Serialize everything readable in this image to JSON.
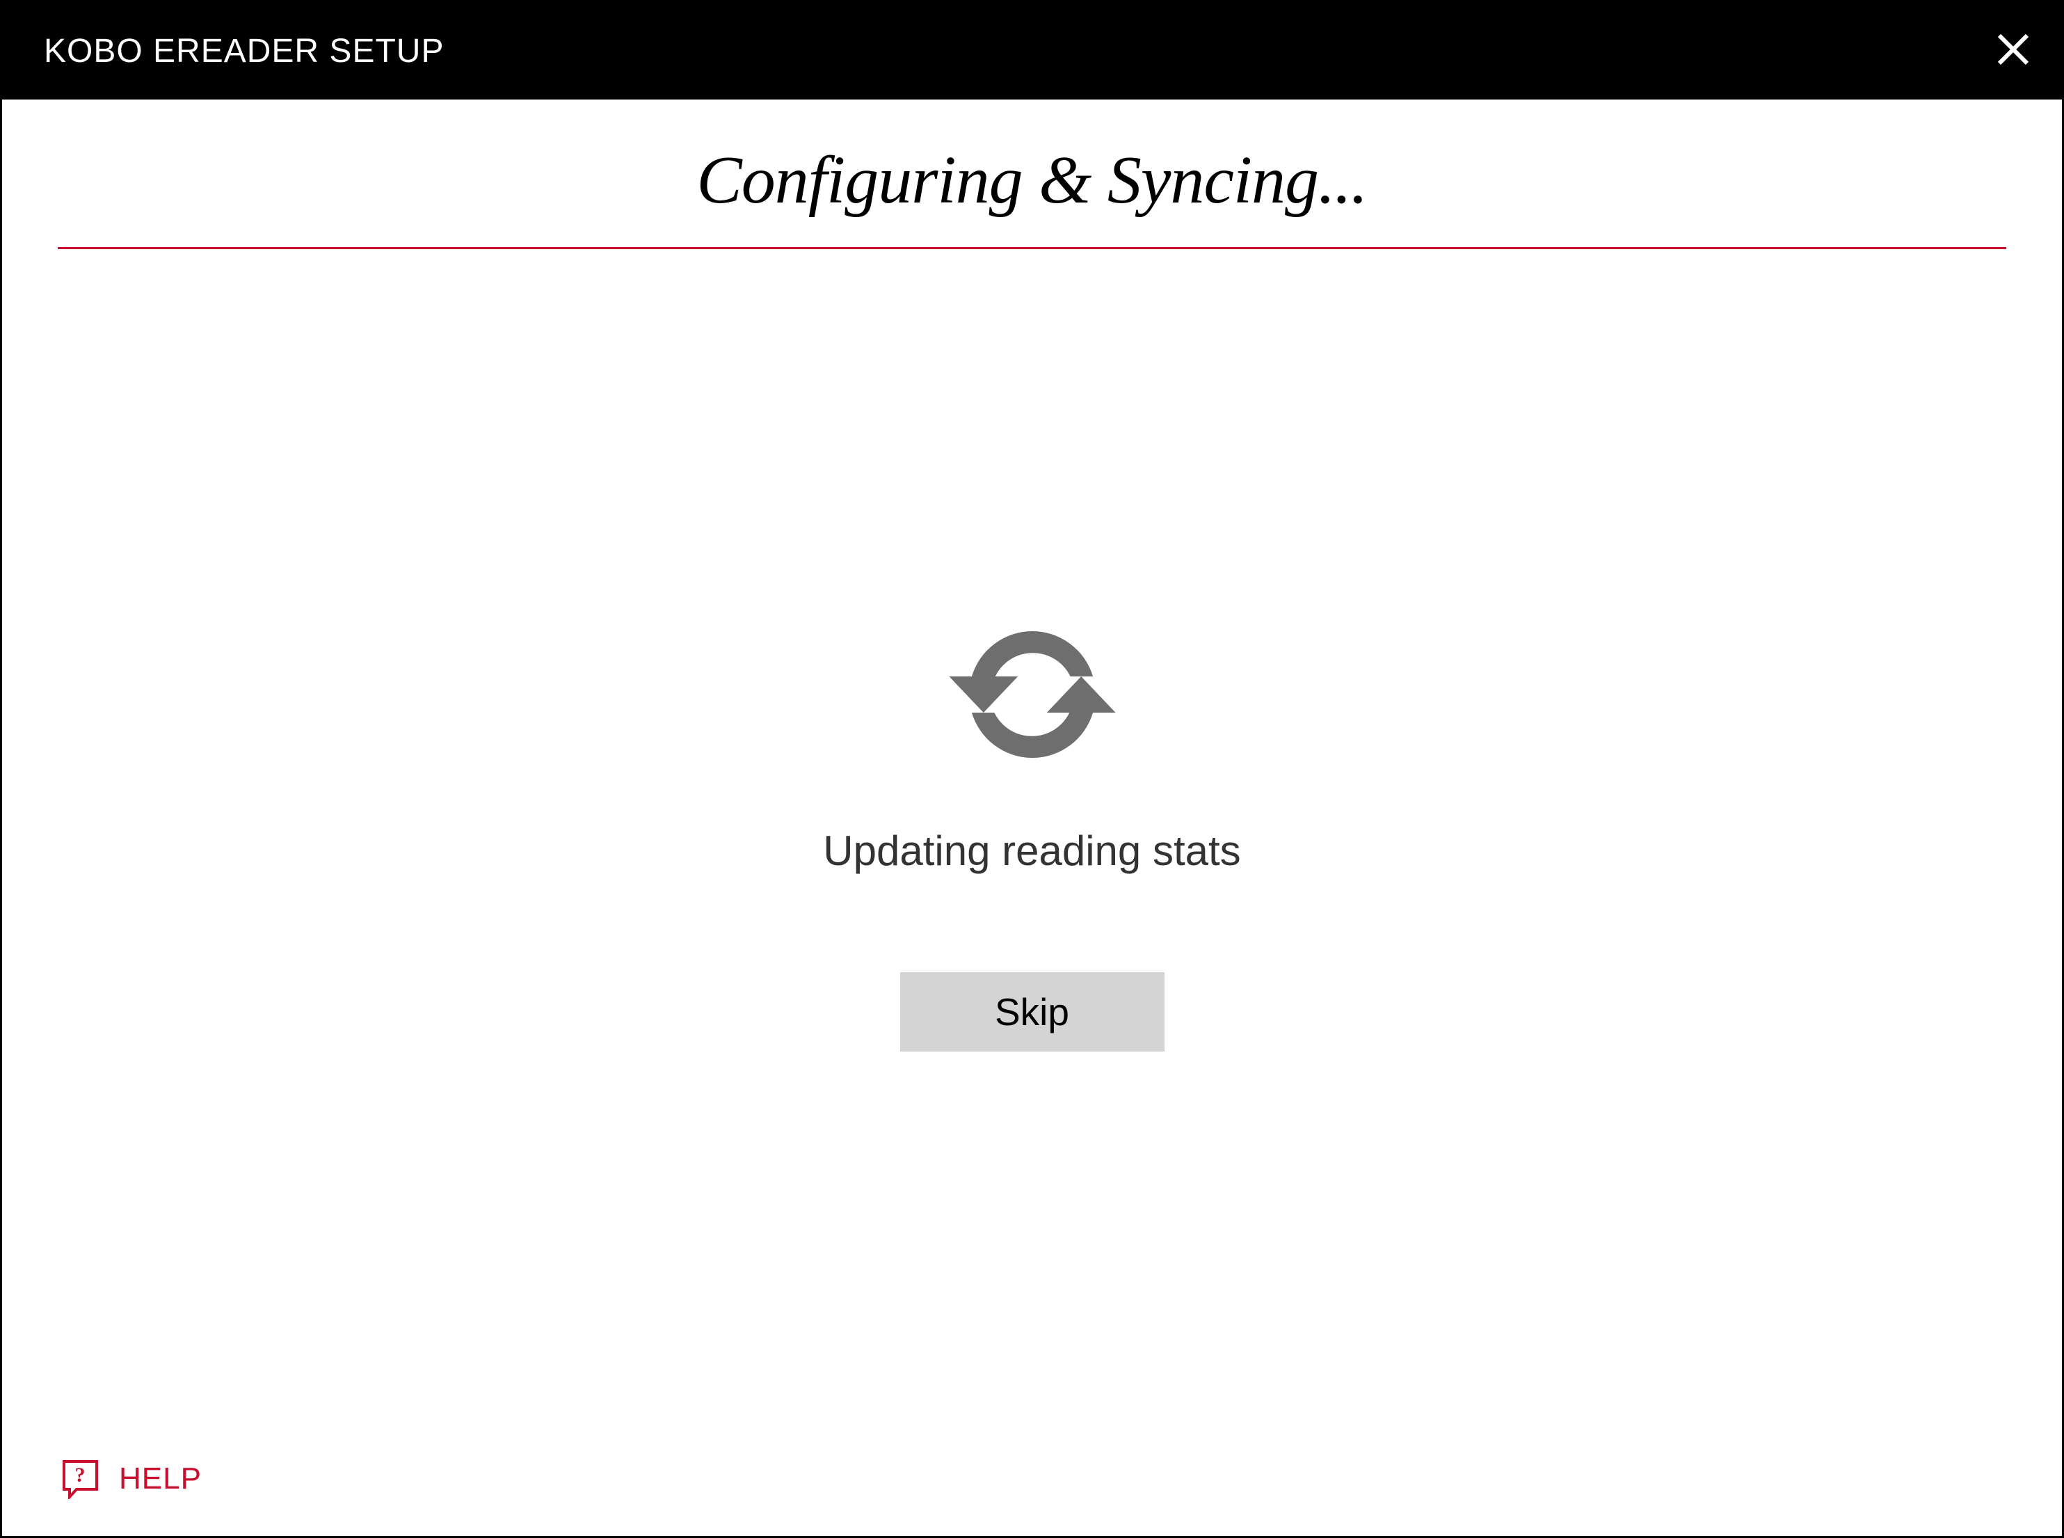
{
  "titleBar": {
    "title": "KOBO EREADER SETUP"
  },
  "heading": "Configuring & Syncing...",
  "statusText": "Updating reading stats",
  "skipButton": "Skip",
  "help": {
    "label": "HELP"
  },
  "colors": {
    "accent": "#c8102e",
    "iconGray": "#6e6e6e",
    "buttonBg": "#d4d4d4",
    "titleBarBg": "#000000"
  }
}
